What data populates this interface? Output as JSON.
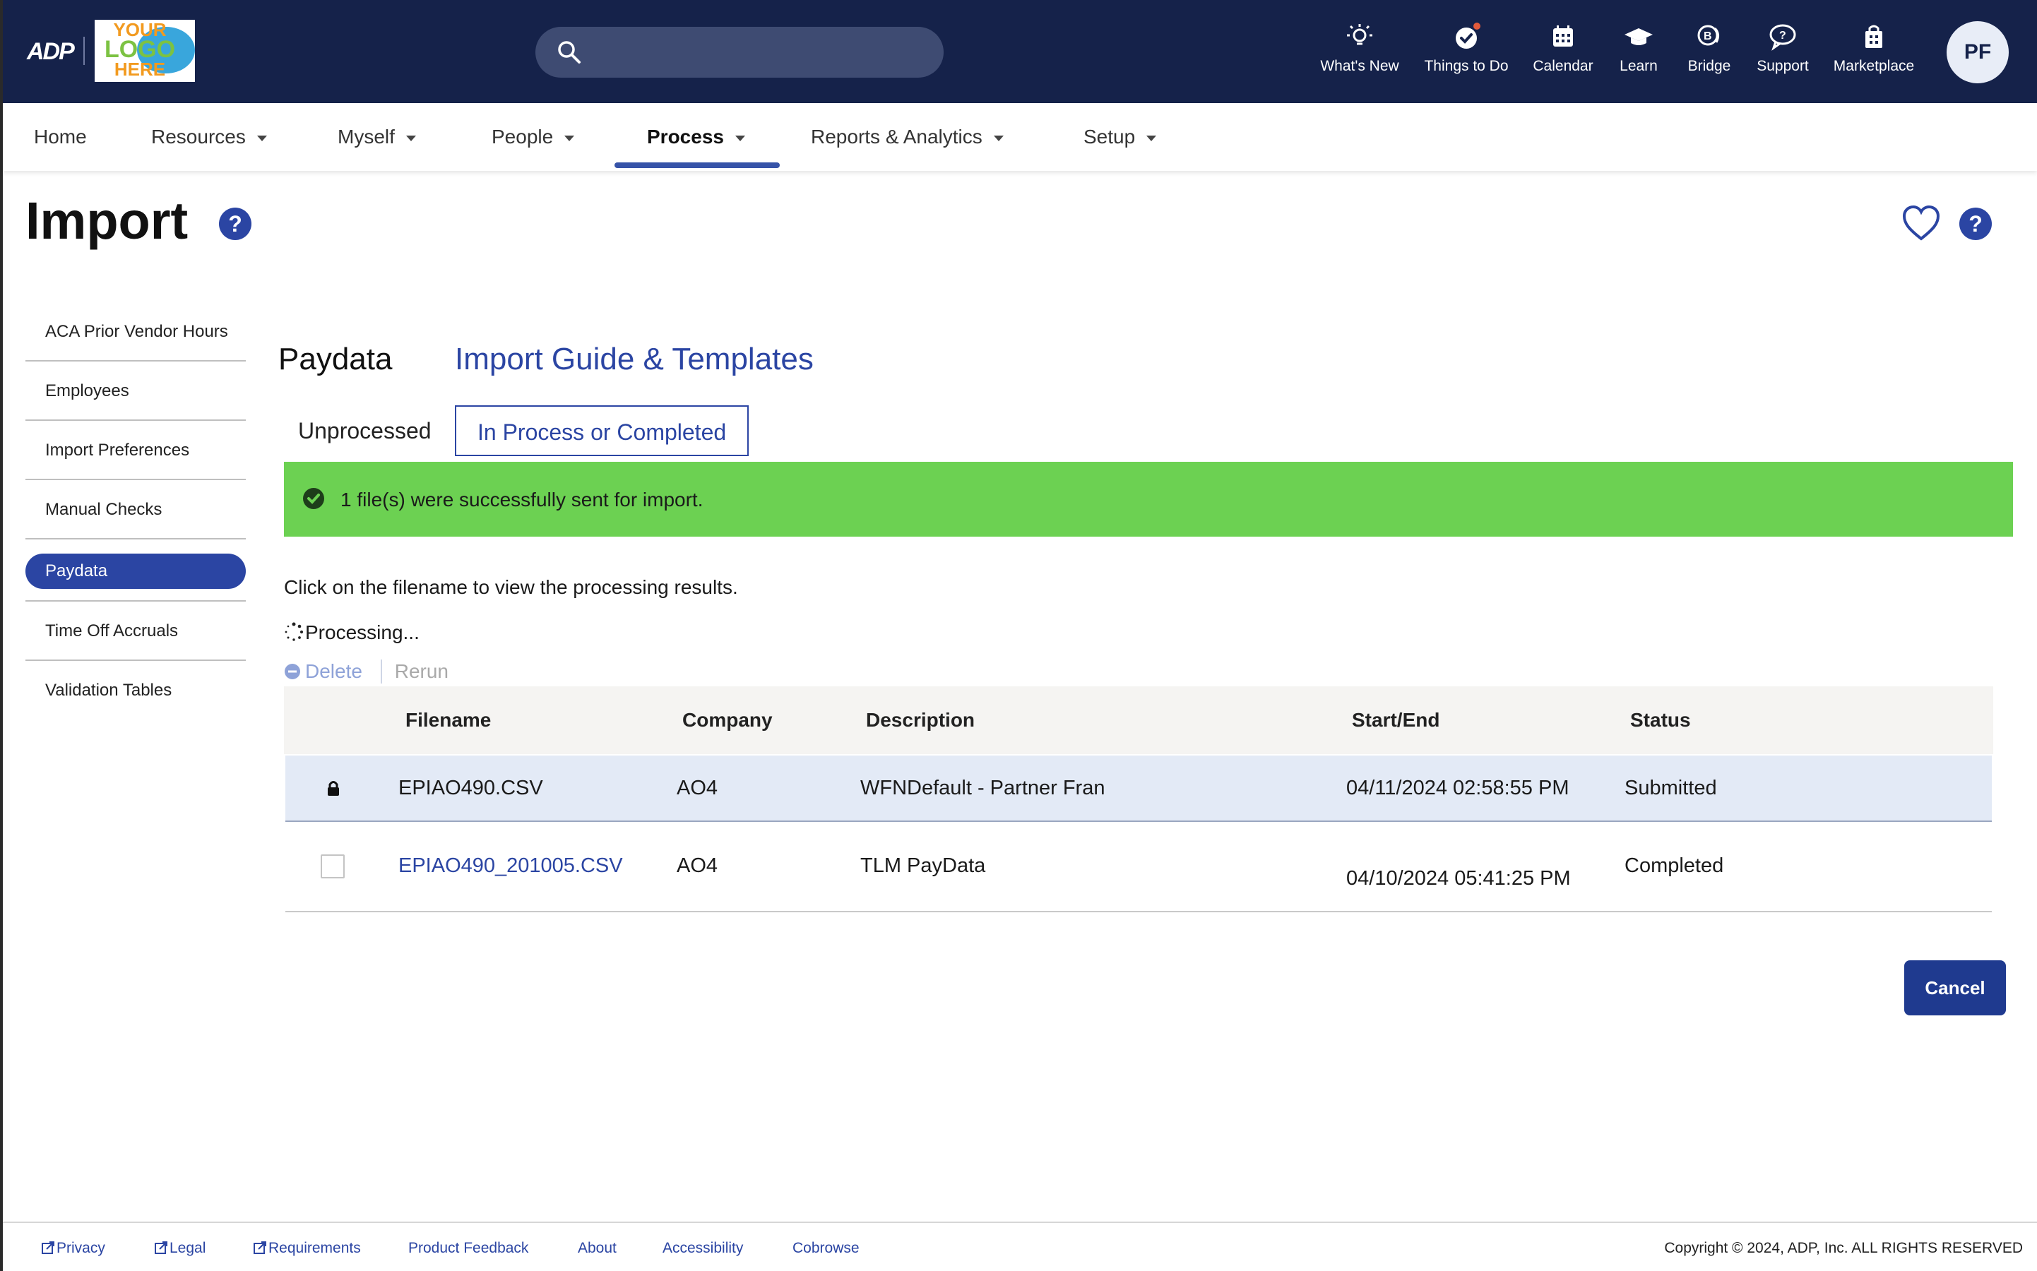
{
  "header": {
    "brand": "ADP",
    "logo_text": {
      "line1": "YOUR",
      "line2": "LOGO",
      "line3": "HERE"
    },
    "search": {
      "placeholder": ""
    },
    "toolbar": [
      {
        "label": "What's New",
        "icon": "lightbulb-icon"
      },
      {
        "label": "Things to Do",
        "icon": "checkmark-circle-icon"
      },
      {
        "label": "Calendar",
        "icon": "calendar-icon"
      },
      {
        "label": "Learn",
        "icon": "graduation-cap-icon"
      },
      {
        "label": "Bridge",
        "icon": "bridge-chat-icon"
      },
      {
        "label": "Support",
        "icon": "support-chat-icon"
      },
      {
        "label": "Marketplace",
        "icon": "shopping-bag-icon"
      }
    ],
    "avatar": "PF"
  },
  "nav": {
    "items": [
      {
        "label": "Home"
      },
      {
        "label": "Resources"
      },
      {
        "label": "Myself"
      },
      {
        "label": "People"
      },
      {
        "label": "Process"
      },
      {
        "label": "Reports & Analytics"
      },
      {
        "label": "Setup"
      }
    ],
    "active": "Process"
  },
  "page": {
    "title": "Import",
    "help": "?"
  },
  "sidebar": {
    "items": [
      {
        "label": "ACA Prior Vendor Hours"
      },
      {
        "label": "Employees"
      },
      {
        "label": "Import Preferences"
      },
      {
        "label": "Manual Checks"
      },
      {
        "label": "Paydata"
      },
      {
        "label": "Time Off Accruals"
      },
      {
        "label": "Validation Tables"
      }
    ],
    "active": "Paydata"
  },
  "content": {
    "section_title": "Paydata",
    "guide_link": "Import Guide & Templates",
    "tabs": [
      {
        "label": "Unprocessed"
      },
      {
        "label": "In Process or Completed"
      }
    ],
    "alert": "1 file(s) were successfully sent for import.",
    "hint": "Click on the filename to view the processing results.",
    "processing": "Processing...",
    "actions": {
      "delete": "Delete",
      "rerun": "Rerun"
    },
    "table": {
      "headers": [
        "Filename",
        "Company",
        "Description",
        "Start/End",
        "Status"
      ],
      "rows": [
        {
          "filename": "EPIAO490.CSV",
          "company": "AO4",
          "description": "WFNDefault - Partner Fran",
          "start_end": "04/11/2024 02:58:55 PM",
          "status": "Submitted"
        },
        {
          "filename": "EPIAO490_201005.CSV",
          "company": "AO4",
          "description": "TLM PayData",
          "start_end": "04/10/2024 05:41:25 PM",
          "status": "Completed"
        }
      ]
    },
    "cancel": "Cancel"
  },
  "footer": {
    "links": [
      {
        "label": "Privacy"
      },
      {
        "label": "Legal"
      },
      {
        "label": "Requirements"
      },
      {
        "label": "Product Feedback"
      },
      {
        "label": "About"
      },
      {
        "label": "Accessibility"
      },
      {
        "label": "Cobrowse"
      }
    ],
    "copyright": "Copyright © 2024, ADP, Inc. ALL RIGHTS RESERVED"
  },
  "colors": {
    "topbar": "#15224a",
    "accent": "#2b45a3",
    "success": "#6cd152",
    "selected_row": "#e3eaf6"
  }
}
